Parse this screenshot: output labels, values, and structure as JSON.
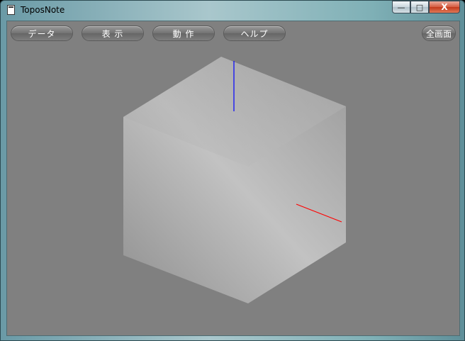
{
  "window": {
    "title": "ToposNote",
    "minimize_glyph": "—",
    "maximize_glyph": "□",
    "close_glyph": "X"
  },
  "toolbar": {
    "data_label": "データ",
    "view_label": "表 示",
    "action_label": "動 作",
    "help_label": "ヘルプ",
    "fullscreen_label": "全画面"
  },
  "viewport": {
    "background_color": "#808080",
    "axis_colors": {
      "x": "#ff0000",
      "z": "#0000ff"
    }
  }
}
